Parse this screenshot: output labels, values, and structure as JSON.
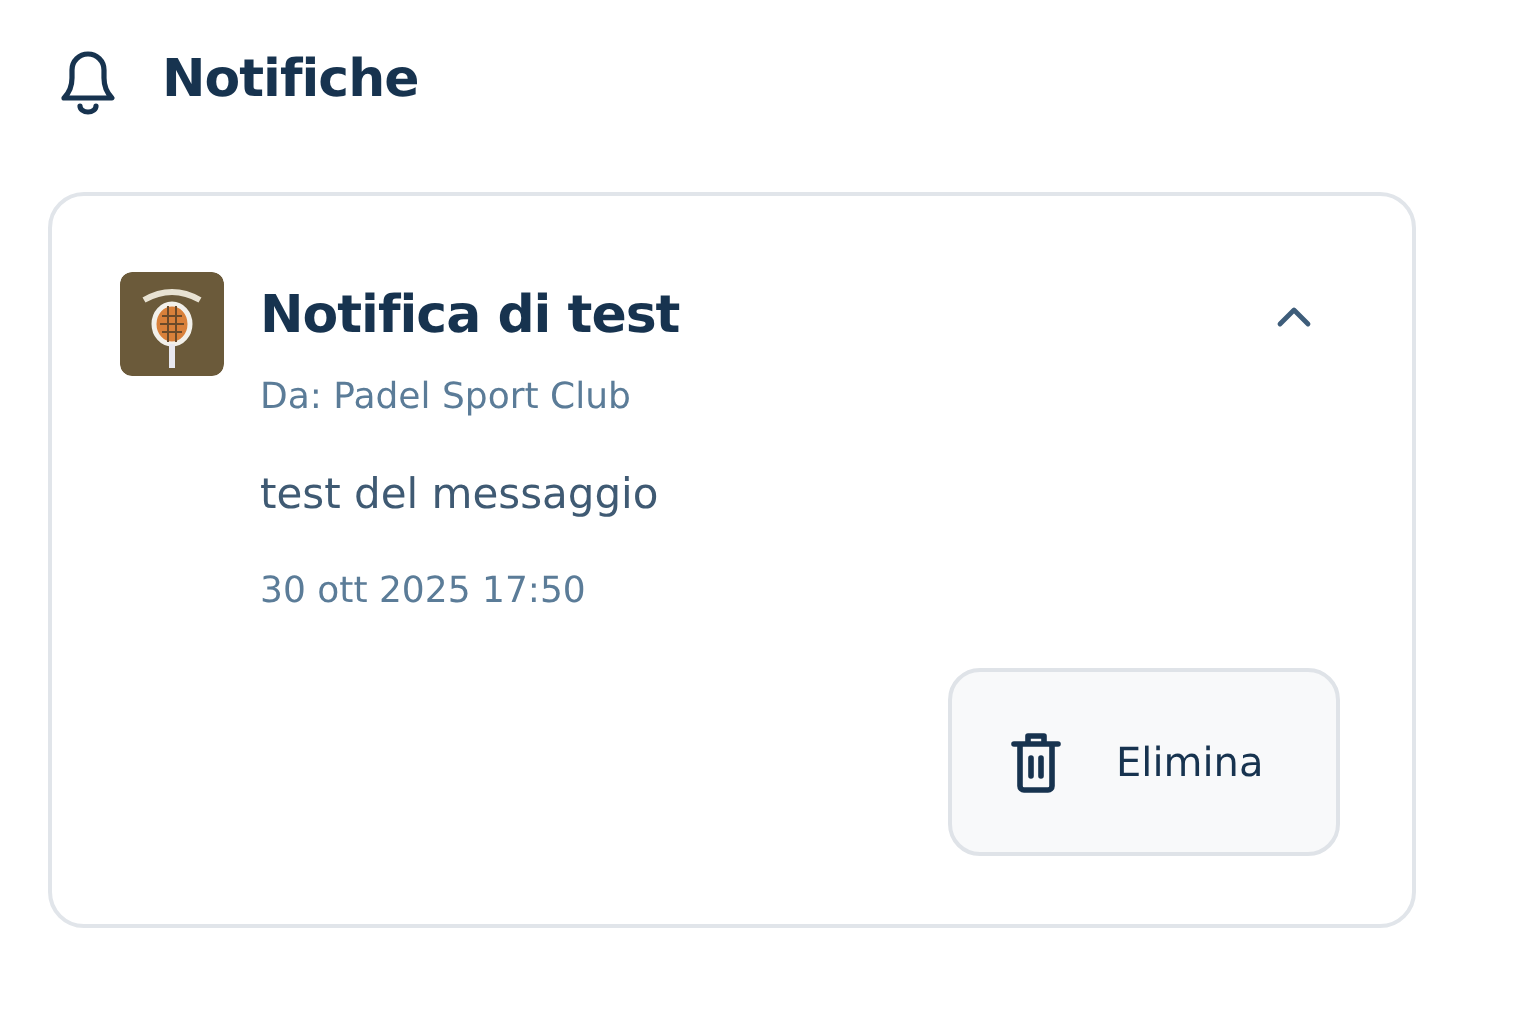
{
  "header": {
    "title": "Notifiche"
  },
  "notifications": [
    {
      "title": "Notifica di test",
      "sender": "Da: Padel Sport Club",
      "message": "test del messaggio",
      "date": "30 ott 2025 17:50",
      "expanded": true,
      "actions": [
        {
          "label": "Elimina",
          "kind": "delete"
        }
      ]
    }
  ]
}
